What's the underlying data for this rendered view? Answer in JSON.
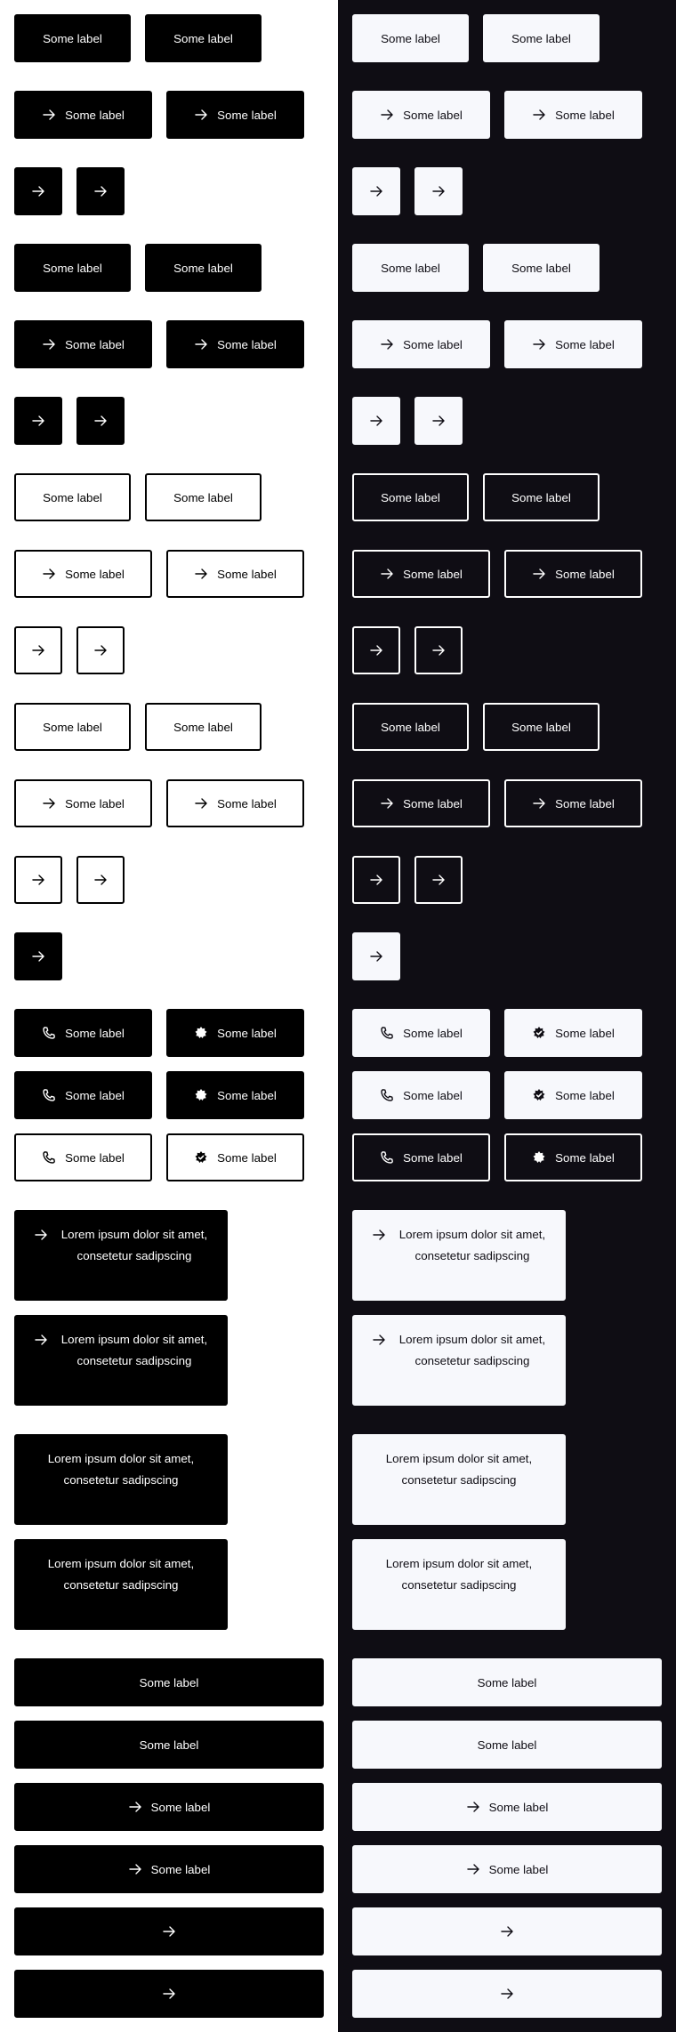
{
  "short_label": "Some label",
  "long_label": "Lorem ipsum dolor sit amet, consetetur sadipscing",
  "icons": {
    "arrow": "arrow-right-icon",
    "phone": "phone-icon",
    "badge": "star-badge-icon"
  },
  "colors": {
    "light_bg": "#ffffff",
    "dark_bg": "#0f0d14",
    "primary_light": "#000000",
    "primary_dark": "#f7f8fc"
  }
}
